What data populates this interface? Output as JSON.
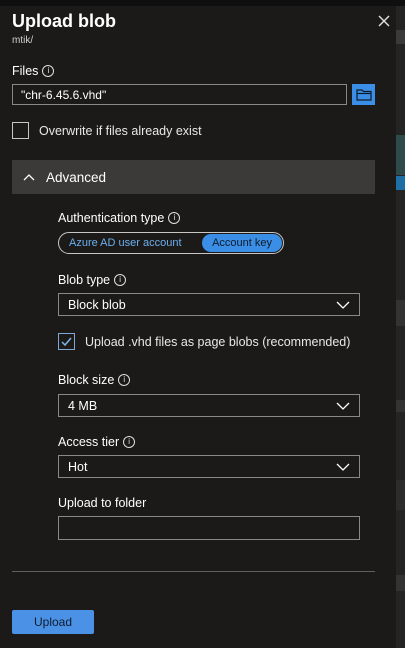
{
  "header": {
    "title": "Upload blob",
    "subtitle": "mtik/"
  },
  "files": {
    "label": "Files",
    "value": "\"chr-6.45.6.vhd\""
  },
  "overwrite": {
    "label": "Overwrite if files already exist",
    "checked": false
  },
  "advanced": {
    "label": "Advanced",
    "expanded": true
  },
  "auth": {
    "label": "Authentication type",
    "options": [
      "Azure AD user account",
      "Account key"
    ],
    "selected": "Account key"
  },
  "blob_type": {
    "label": "Blob type",
    "value": "Block blob"
  },
  "page_blobs": {
    "label": "Upload .vhd files as page blobs (recommended)",
    "checked": true
  },
  "block_size": {
    "label": "Block size",
    "value": "4 MB"
  },
  "access_tier": {
    "label": "Access tier",
    "value": "Hot"
  },
  "folder": {
    "label": "Upload to folder",
    "value": ""
  },
  "footer": {
    "upload_label": "Upload"
  },
  "colors": {
    "background": "#1b1a19",
    "accent": "#3a8ee6",
    "section_header": "#3b3a39"
  }
}
